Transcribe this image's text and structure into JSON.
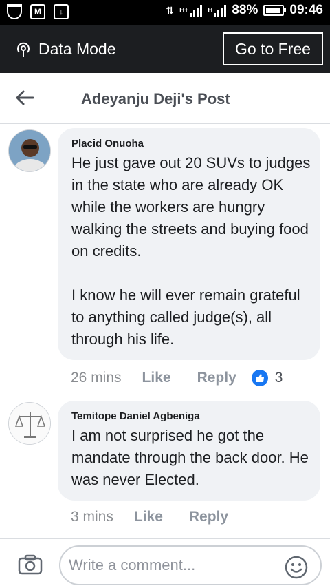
{
  "status_bar": {
    "network_label": "1",
    "signal1_label": "H+",
    "signal2_label": "H",
    "battery_percent": "88%",
    "time": "09:46"
  },
  "data_bar": {
    "mode_label": "Data Mode",
    "go_free_label": "Go to Free"
  },
  "header": {
    "title": "Adeyanju Deji's Post"
  },
  "comments": [
    {
      "author": "Placid Onuoha",
      "text": "He just gave out 20 SUVs to judges in the state who are already OK while the workers are hungry walking the streets and buying food on credits.\n\nI know he will ever remain grateful to anything called judge(s), all through his life.",
      "time": "26 mins",
      "like_label": "Like",
      "reply_label": "Reply",
      "reaction_count": "3"
    },
    {
      "author": "Temitope Daniel Agbeniga",
      "text": "I am not surprised he got the mandate through the back door. He was never Elected.",
      "time": "3 mins",
      "like_label": "Like",
      "reply_label": "Reply"
    }
  ],
  "composer": {
    "placeholder": "Write a comment..."
  },
  "colors": {
    "status_bar": "#000000",
    "data_bar": "#1c1e21",
    "bubble": "#f0f2f5",
    "like_blue": "#1877f2"
  }
}
